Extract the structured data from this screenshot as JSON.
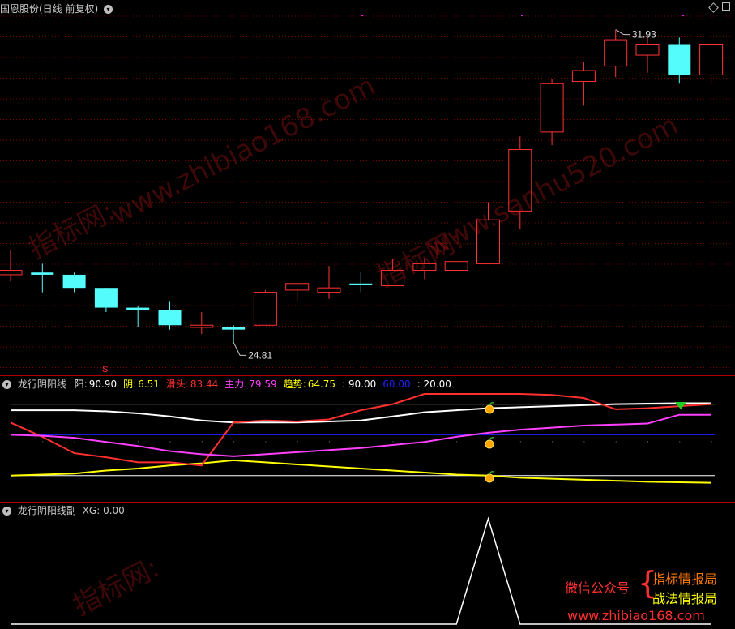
{
  "main_panel": {
    "title": "国恩股份(日线 前复权)",
    "high_label": "31.93",
    "low_label": "24.81",
    "s_marker": "S"
  },
  "ind_panel": {
    "title": "龙行阴阳线",
    "legend": [
      {
        "label": "阳:",
        "value": "90.90",
        "color": "#ffffff"
      },
      {
        "label": "阴:",
        "value": "6.51",
        "color": "#ffff00"
      },
      {
        "label": "滑头:",
        "value": "83.44",
        "color": "#ff3030"
      },
      {
        "label": "主力:",
        "value": "79.59",
        "color": "#ff40ff"
      },
      {
        "label": "趋势:",
        "value": "64.75",
        "color": "#ffff00"
      },
      {
        "label": "",
        "value": ": 90.00",
        "color": "#ffffff"
      },
      {
        "label": "",
        "value": "60.00",
        "color": "#2020ff"
      },
      {
        "label": "",
        "value": ": 20.00",
        "color": "#ffffff"
      }
    ]
  },
  "sub_panel": {
    "title": "龙行阴阳线副",
    "xg_label": "XG:",
    "xg_value": "0.00"
  },
  "watermarks": [
    "www.zhibiao168.com",
    "www.sanhu520.com",
    "指标网:",
    "指标网:",
    "指标网:"
  ],
  "promo": {
    "left": "微信公众号",
    "line1": "指标情报局",
    "line2": "战法情报局",
    "url": "www.zhibiao168.com"
  },
  "colors": {
    "up": "#ff3232",
    "down": "#54fcfc",
    "grid": "#7a0000",
    "border": "#b00000"
  },
  "chart_data": [
    {
      "type": "candlestick",
      "series_name": "国恩股份",
      "ylim": [
        24.3,
        32.2
      ],
      "candles": [
        {
          "o": 26.45,
          "h": 26.9,
          "l": 26.2,
          "c": 26.35,
          "dir": "up"
        },
        {
          "o": 26.4,
          "h": 26.6,
          "l": 25.95,
          "c": 26.35,
          "dir": "down"
        },
        {
          "o": 26.35,
          "h": 26.4,
          "l": 25.95,
          "c": 26.05,
          "dir": "down"
        },
        {
          "o": 26.05,
          "h": 26.05,
          "l": 25.5,
          "c": 25.6,
          "dir": "down"
        },
        {
          "o": 25.6,
          "h": 25.65,
          "l": 25.15,
          "c": 25.55,
          "dir": "down"
        },
        {
          "o": 25.55,
          "h": 25.75,
          "l": 25.1,
          "c": 25.2,
          "dir": "down"
        },
        {
          "o": 25.15,
          "h": 25.5,
          "l": 25.0,
          "c": 25.2,
          "dir": "up"
        },
        {
          "o": 25.15,
          "h": 25.2,
          "l": 24.81,
          "c": 25.1,
          "dir": "down"
        },
        {
          "o": 25.2,
          "h": 26.0,
          "l": 25.2,
          "c": 25.95,
          "dir": "up"
        },
        {
          "o": 26.0,
          "h": 26.15,
          "l": 25.75,
          "c": 26.15,
          "dir": "up"
        },
        {
          "o": 25.95,
          "h": 26.55,
          "l": 25.8,
          "c": 26.05,
          "dir": "up"
        },
        {
          "o": 26.15,
          "h": 26.4,
          "l": 25.95,
          "c": 26.15,
          "dir": "down"
        },
        {
          "o": 26.1,
          "h": 26.7,
          "l": 26.1,
          "c": 26.45,
          "dir": "up"
        },
        {
          "o": 26.45,
          "h": 26.7,
          "l": 26.25,
          "c": 26.6,
          "dir": "up"
        },
        {
          "o": 26.45,
          "h": 26.65,
          "l": 26.45,
          "c": 26.65,
          "dir": "up"
        },
        {
          "o": 26.6,
          "h": 28.0,
          "l": 26.6,
          "c": 27.6,
          "dir": "up"
        },
        {
          "o": 27.8,
          "h": 29.5,
          "l": 27.4,
          "c": 29.2,
          "dir": "up"
        },
        {
          "o": 29.6,
          "h": 30.8,
          "l": 29.3,
          "c": 30.7,
          "dir": "up"
        },
        {
          "o": 30.75,
          "h": 31.2,
          "l": 30.2,
          "c": 31.0,
          "dir": "up"
        },
        {
          "o": 31.1,
          "h": 31.93,
          "l": 30.85,
          "c": 31.7,
          "dir": "up"
        },
        {
          "o": 31.35,
          "h": 31.75,
          "l": 30.95,
          "c": 31.6,
          "dir": "up"
        },
        {
          "o": 31.6,
          "h": 31.75,
          "l": 30.7,
          "c": 30.9,
          "dir": "down"
        },
        {
          "o": 30.9,
          "h": 31.6,
          "l": 30.7,
          "c": 31.6,
          "dir": "up"
        }
      ]
    },
    {
      "type": "line",
      "title": "龙行阴阳线",
      "ylim": [
        0,
        100
      ],
      "series": [
        {
          "name": "阳",
          "color": "#ffffff",
          "values": [
            84,
            84,
            84,
            83,
            81,
            78,
            74,
            72,
            72,
            72,
            73,
            74,
            78,
            82,
            84,
            86,
            87,
            88,
            89,
            90,
            90.5,
            90.9,
            90.9
          ]
        },
        {
          "name": "阴",
          "color": "#ffff00",
          "values": [
            20,
            21,
            22,
            25,
            27,
            30,
            32,
            35,
            33,
            31,
            29,
            27,
            25,
            23,
            21,
            20,
            18,
            17,
            16,
            15,
            14,
            13.5,
            13
          ]
        },
        {
          "name": "滑头",
          "color": "#ff3030",
          "values": [
            72,
            58,
            42,
            38,
            33,
            33,
            30,
            72,
            74,
            73,
            75,
            84,
            90,
            100,
            100,
            100,
            100,
            99,
            96,
            85,
            86,
            88,
            90
          ]
        },
        {
          "name": "主力",
          "color": "#ff40ff",
          "values": [
            60,
            59,
            57,
            53,
            49,
            44,
            41,
            39,
            41,
            43,
            45,
            47,
            50,
            53,
            58,
            62,
            65,
            67,
            69,
            70,
            71,
            79.59,
            79.59
          ]
        }
      ],
      "hlines": [
        {
          "name": "90.00",
          "value": 90,
          "color": "#ffffff"
        },
        {
          "name": "60.00",
          "value": 60,
          "color": "#2020ff"
        },
        {
          "name": "20.00",
          "value": 20,
          "color": "#ffffff"
        }
      ],
      "trend_value": 64.75
    },
    {
      "type": "line",
      "title": "龙行阴阳线副",
      "series": [
        {
          "name": "XG",
          "values": [
            0,
            0,
            0,
            0,
            0,
            0,
            0,
            0,
            0,
            0,
            0,
            0,
            0,
            0,
            0,
            1,
            0,
            0,
            0,
            0,
            0,
            0,
            0
          ]
        }
      ]
    }
  ]
}
